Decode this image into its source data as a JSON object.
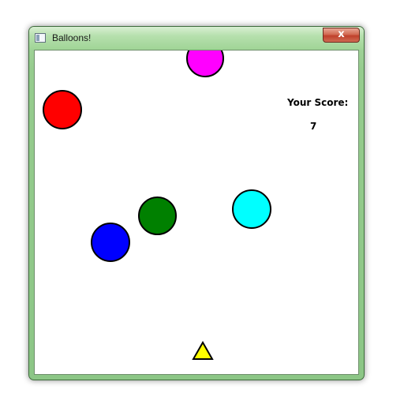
{
  "window": {
    "title": "Balloons!",
    "close_label": "x"
  },
  "score": {
    "label": "Your Score:",
    "value": "7"
  },
  "balloons": [
    {
      "color_name": "magenta",
      "color": "#ff00ff"
    },
    {
      "color_name": "red",
      "color": "#ff0000"
    },
    {
      "color_name": "green",
      "color": "#008000"
    },
    {
      "color_name": "cyan",
      "color": "#00ffff"
    },
    {
      "color_name": "blue",
      "color": "#0000ff"
    }
  ],
  "player": {
    "shape": "triangle",
    "color": "#ffff00"
  }
}
